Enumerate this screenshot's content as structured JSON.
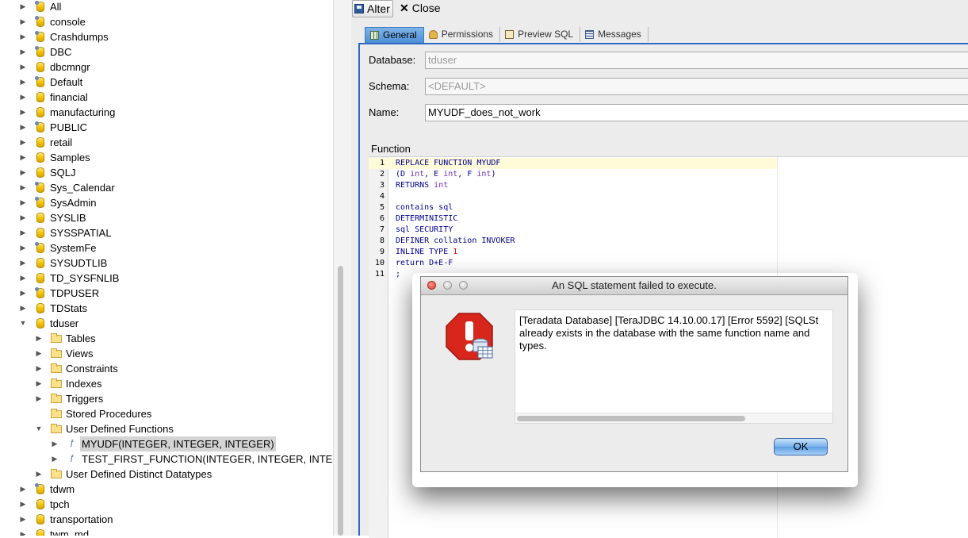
{
  "tree": {
    "items": [
      {
        "label": "All",
        "icon": "database-user-icon",
        "depth": 0,
        "arrow": "collapsed"
      },
      {
        "label": "console",
        "icon": "database-user-icon",
        "depth": 0,
        "arrow": "collapsed"
      },
      {
        "label": "Crashdumps",
        "icon": "database-user-icon",
        "depth": 0,
        "arrow": "collapsed"
      },
      {
        "label": "DBC",
        "icon": "database-user-icon",
        "depth": 0,
        "arrow": "collapsed"
      },
      {
        "label": "dbcmngr",
        "icon": "database-icon",
        "depth": 0,
        "arrow": "collapsed"
      },
      {
        "label": "Default",
        "icon": "database-user-icon",
        "depth": 0,
        "arrow": "collapsed"
      },
      {
        "label": "financial",
        "icon": "database-icon",
        "depth": 0,
        "arrow": "collapsed"
      },
      {
        "label": "manufacturing",
        "icon": "database-icon",
        "depth": 0,
        "arrow": "collapsed"
      },
      {
        "label": "PUBLIC",
        "icon": "database-user-icon",
        "depth": 0,
        "arrow": "collapsed"
      },
      {
        "label": "retail",
        "icon": "database-icon",
        "depth": 0,
        "arrow": "collapsed"
      },
      {
        "label": "Samples",
        "icon": "database-icon",
        "depth": 0,
        "arrow": "collapsed"
      },
      {
        "label": "SQLJ",
        "icon": "database-icon",
        "depth": 0,
        "arrow": "collapsed"
      },
      {
        "label": "Sys_Calendar",
        "icon": "database-user-icon",
        "depth": 0,
        "arrow": "collapsed"
      },
      {
        "label": "SysAdmin",
        "icon": "database-user-icon",
        "depth": 0,
        "arrow": "collapsed"
      },
      {
        "label": "SYSLIB",
        "icon": "database-icon",
        "depth": 0,
        "arrow": "collapsed"
      },
      {
        "label": "SYSSPATIAL",
        "icon": "database-icon",
        "depth": 0,
        "arrow": "collapsed"
      },
      {
        "label": "SystemFe",
        "icon": "database-user-icon",
        "depth": 0,
        "arrow": "collapsed"
      },
      {
        "label": "SYSUDTLIB",
        "icon": "database-icon",
        "depth": 0,
        "arrow": "collapsed"
      },
      {
        "label": "TD_SYSFNLIB",
        "icon": "database-icon",
        "depth": 0,
        "arrow": "collapsed"
      },
      {
        "label": "TDPUSER",
        "icon": "database-user-icon",
        "depth": 0,
        "arrow": "collapsed"
      },
      {
        "label": "TDStats",
        "icon": "database-icon",
        "depth": 0,
        "arrow": "collapsed"
      },
      {
        "label": "tduser",
        "icon": "database-icon",
        "depth": 0,
        "arrow": "expanded"
      },
      {
        "label": "Tables",
        "icon": "folder-icon",
        "depth": 1,
        "arrow": "collapsed"
      },
      {
        "label": "Views",
        "icon": "folder-icon",
        "depth": 1,
        "arrow": "collapsed"
      },
      {
        "label": "Constraints",
        "icon": "folder-icon",
        "depth": 1,
        "arrow": "collapsed"
      },
      {
        "label": "Indexes",
        "icon": "folder-icon",
        "depth": 1,
        "arrow": "collapsed"
      },
      {
        "label": "Triggers",
        "icon": "folder-icon",
        "depth": 1,
        "arrow": "collapsed"
      },
      {
        "label": "Stored Procedures",
        "icon": "folder-icon",
        "depth": 1,
        "arrow": "none"
      },
      {
        "label": "User Defined Functions",
        "icon": "folder-open-icon",
        "depth": 1,
        "arrow": "expanded"
      },
      {
        "label": "MYUDF(INTEGER, INTEGER, INTEGER)",
        "icon": "function-icon",
        "depth": 2,
        "arrow": "collapsed",
        "selected": true
      },
      {
        "label": "TEST_FIRST_FUNCTION(INTEGER, INTEGER, INTEGER)",
        "icon": "function-icon",
        "depth": 2,
        "arrow": "collapsed"
      },
      {
        "label": "User Defined Distinct Datatypes",
        "icon": "folder-icon",
        "depth": 1,
        "arrow": "collapsed"
      },
      {
        "label": "tdwm",
        "icon": "database-user-icon",
        "depth": 0,
        "arrow": "collapsed"
      },
      {
        "label": "tpch",
        "icon": "database-icon",
        "depth": 0,
        "arrow": "collapsed"
      },
      {
        "label": "transportation",
        "icon": "database-icon",
        "depth": 0,
        "arrow": "collapsed"
      },
      {
        "label": "twm_md",
        "icon": "database-icon",
        "depth": 0,
        "arrow": "collapsed"
      }
    ]
  },
  "toolbar": {
    "alter_label": "Alter",
    "close_label": "Close"
  },
  "tabs": [
    {
      "label": "General",
      "icon": "grid-icon",
      "active": true
    },
    {
      "label": "Permissions",
      "icon": "key-icon",
      "active": false
    },
    {
      "label": "Preview SQL",
      "icon": "sql-icon",
      "active": false
    },
    {
      "label": "Messages",
      "icon": "messages-icon",
      "active": false
    }
  ],
  "form": {
    "database_label": "Database:",
    "database_value": "tduser",
    "schema_label": "Schema:",
    "schema_value": "<DEFAULT>",
    "name_label": "Name:",
    "name_value": "MYUDF_does_not_work",
    "function_label": "Function"
  },
  "code_lines": [
    {
      "n": "1",
      "text": "REPLACE FUNCTION MYUDF"
    },
    {
      "n": "2",
      "text": "(D int, E int, F int)"
    },
    {
      "n": "3",
      "text": "RETURNS int"
    },
    {
      "n": "4",
      "text": ""
    },
    {
      "n": "5",
      "text": "contains sql"
    },
    {
      "n": "6",
      "text": "DETERMINISTIC"
    },
    {
      "n": "7",
      "text": "sql SECURITY"
    },
    {
      "n": "8",
      "text": "DEFINER collation INVOKER"
    },
    {
      "n": "9",
      "text": "INLINE TYPE 1"
    },
    {
      "n": "10",
      "text": "return D+E-F"
    },
    {
      "n": "11",
      "text": ";"
    }
  ],
  "dialog": {
    "title": "An SQL statement failed to execute.",
    "message": "[Teradata Database] [TeraJDBC 14.10.00.17] [Error 5592] [SQLSt already exists in the database with the same function name and types.",
    "ok_label": "OK"
  },
  "colors": {
    "accent": "#2d68c4",
    "selection": "#d4d4d4",
    "error_red": "#d7261c"
  }
}
